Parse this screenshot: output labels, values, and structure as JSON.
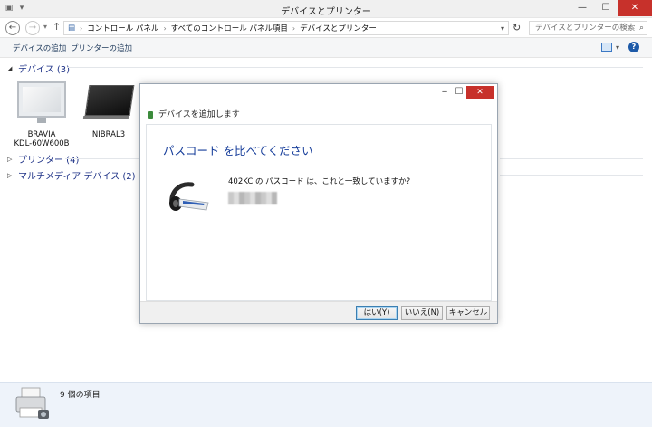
{
  "window": {
    "title": "デバイスとプリンター",
    "controls": {
      "minimize": "—",
      "maximize": "☐",
      "close": "✕"
    }
  },
  "address": {
    "back_icon": "back-arrow-icon",
    "forward_icon": "forward-arrow-icon",
    "up_icon": "up-arrow-icon",
    "crumbs": [
      "コントロール パネル",
      "すべてのコントロール パネル項目",
      "デバイスとプリンター"
    ],
    "search_placeholder": "デバイスとプリンターの検索"
  },
  "commands": {
    "add_device": "デバイスの追加",
    "add_printer": "プリンターの追加"
  },
  "groups": {
    "devices": "デバイス (3)",
    "printers": "プリンター (4)",
    "multimedia": "マルチメディア デバイス (2)"
  },
  "devices": [
    {
      "line1": "BRAVIA",
      "line2": "KDL-60W600B",
      "icon": "tv-icon"
    },
    {
      "line1": "NIBRAL3",
      "line2": "",
      "icon": "tablet-icon"
    }
  ],
  "dialog": {
    "caption": "デバイスを追加します",
    "heading": "パスコード を比べてください",
    "question": "402KC の パスコード は、これと一致していますか?",
    "buttons": {
      "yes": "はい(Y)",
      "no": "いいえ(N)",
      "cancel": "キャンセル"
    }
  },
  "status": {
    "count": "9 個の項目"
  },
  "colors": {
    "close_red": "#c7312b",
    "heading_blue": "#163d9a",
    "group_blue": "#1e3287",
    "details_bg": "#eef3fa"
  }
}
